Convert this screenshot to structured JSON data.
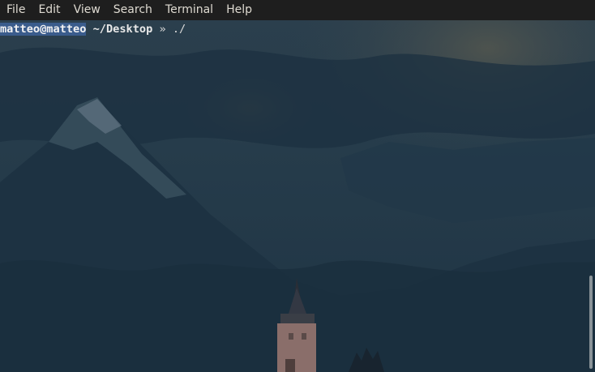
{
  "menubar": {
    "items": [
      "File",
      "Edit",
      "View",
      "Search",
      "Terminal",
      "Help"
    ]
  },
  "terminal": {
    "prompt_user": "matteo@matteo",
    "prompt_path": "~/Desktop",
    "prompt_arrow": "»",
    "command": "./"
  },
  "scrollbar": {
    "position_fraction": 0.74
  },
  "colors": {
    "menubar_bg": "#1e1e1e",
    "terminal_bg": "#213746",
    "selection": "#3a5c8c"
  }
}
